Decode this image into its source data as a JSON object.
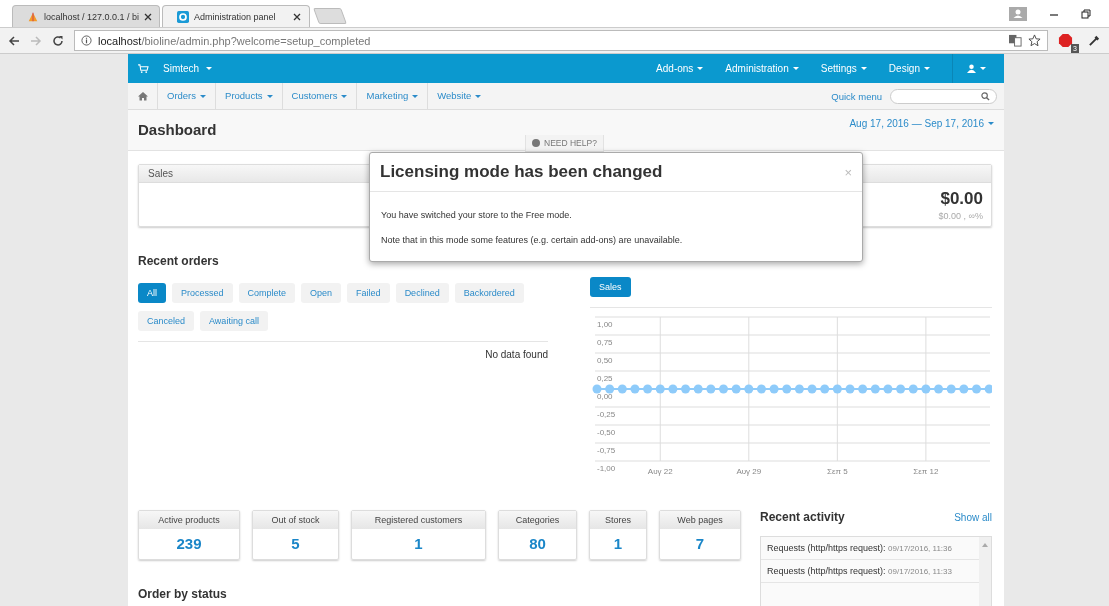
{
  "browser": {
    "tabs": [
      {
        "title": "localhost / 127.0.0.1 / bi",
        "selected": false
      },
      {
        "title": "Administration panel",
        "selected": true
      }
    ],
    "url_host": "localhost",
    "url_path": "/bioline/admin.php?welcome=setup_completed",
    "extension_badge": "3"
  },
  "topnav": {
    "brand": "Simtech",
    "items": [
      "Add-ons",
      "Administration",
      "Settings",
      "Design"
    ]
  },
  "subnav": {
    "items": [
      "Orders",
      "Products",
      "Customers",
      "Marketing",
      "Website"
    ],
    "quick_menu": "Quick menu"
  },
  "header": {
    "title": "Dashboard",
    "date_range": "Aug 17, 2016 — Sep 17, 2016",
    "help": "NEED HELP?"
  },
  "sales": {
    "title": "Sales",
    "total": "$0.00",
    "sub": "$0.00 , ∞%"
  },
  "recent_orders": {
    "title": "Recent orders",
    "filters": [
      {
        "label": "All",
        "selected": true
      },
      {
        "label": "Processed",
        "selected": false
      },
      {
        "label": "Complete",
        "selected": false
      },
      {
        "label": "Open",
        "selected": false
      },
      {
        "label": "Failed",
        "selected": false
      },
      {
        "label": "Declined",
        "selected": false
      },
      {
        "label": "Backordered",
        "selected": false
      },
      {
        "label": "Canceled",
        "selected": false
      },
      {
        "label": "Awaiting call",
        "selected": false
      }
    ],
    "empty": "No data found"
  },
  "statistics": {
    "tabs": [
      {
        "label": "Sales",
        "selected": true
      }
    ],
    "chart_data": {
      "type": "line",
      "categories": [
        null,
        null,
        null,
        null,
        null,
        "Αυγ 22",
        null,
        null,
        null,
        null,
        null,
        null,
        "Αυγ 29",
        null,
        null,
        null,
        null,
        null,
        null,
        "Σεπ 5",
        null,
        null,
        null,
        null,
        null,
        null,
        "Σεπ 12",
        null,
        null,
        null,
        null,
        null
      ],
      "series": [
        {
          "color": "#8ecbfa",
          "marker": "circle",
          "values": [
            0,
            0,
            0,
            0,
            0,
            0,
            0,
            0,
            0,
            0,
            0,
            0,
            0,
            0,
            0,
            0,
            0,
            0,
            0,
            0,
            0,
            0,
            0,
            0,
            0,
            0,
            0,
            0,
            0,
            0,
            0,
            0
          ]
        }
      ],
      "ylim": [
        -1,
        1
      ],
      "grid": true,
      "yticks": [
        {
          "value": 1,
          "label": "1,00"
        },
        {
          "value": 0.75,
          "label": "0,75"
        },
        {
          "value": 0.5,
          "label": "0,50"
        },
        {
          "value": 0.25,
          "label": "0,25"
        },
        {
          "value": 0,
          "label": "0,00"
        },
        {
          "value": -0.25,
          "label": "-0,25"
        },
        {
          "value": -0.5,
          "label": "-0,50"
        },
        {
          "value": -0.75,
          "label": "-0,75"
        },
        {
          "value": -1,
          "label": "-1,00"
        }
      ]
    }
  },
  "counters": [
    {
      "label": "Active products",
      "value": "239"
    },
    {
      "label": "Out of stock",
      "value": "5"
    },
    {
      "label": "Registered customers",
      "value": "1"
    },
    {
      "label": "Categories",
      "value": "80"
    },
    {
      "label": "Stores",
      "value": "1"
    },
    {
      "label": "Web pages",
      "value": "7"
    }
  ],
  "recent_activity": {
    "title": "Recent activity",
    "show_all": "Show all",
    "items": [
      {
        "text": "Requests (http/https request):",
        "time": "09/17/2016, 11:36"
      },
      {
        "text": "Requests (http/https request):",
        "time": "09/17/2016, 11:33"
      }
    ]
  },
  "order_by_status": {
    "title": "Order by status"
  },
  "modal": {
    "title": "Licensing mode has been changed",
    "close": "×",
    "paragraphs": [
      "You have switched your store to the Free mode.",
      "Note that in this mode some features (e.g. certain add-ons) are unavailable."
    ]
  }
}
